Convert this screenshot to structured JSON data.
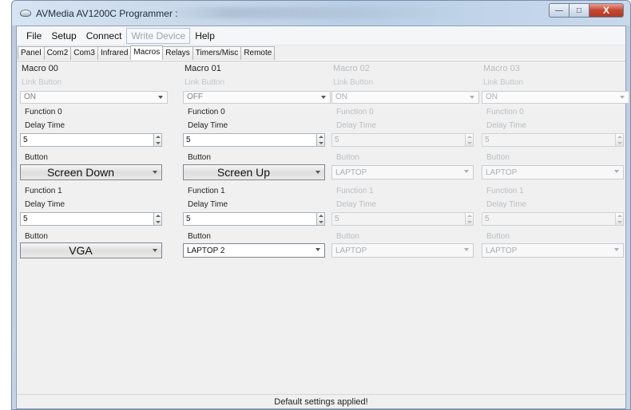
{
  "window": {
    "title": "AVMedia AV1200C Programmer :",
    "minimize_glyph": "—",
    "maximize_glyph": "□",
    "close_glyph": "X"
  },
  "menu": [
    "File",
    "Setup",
    "Connect",
    "Write Device",
    "Help"
  ],
  "tabs": [
    "Panel",
    "Com2",
    "Com3",
    "Infrared",
    "Macros",
    "Relays",
    "Timers/Misc",
    "Remote"
  ],
  "active_tab": "Macros",
  "macros": [
    {
      "title": "Macro 00",
      "link_label": "Link Button",
      "link_value": "ON",
      "f0_label": "Function 0",
      "f0_delay_label": "Delay Time",
      "f0_delay": "5",
      "f0_button_label": "Button",
      "f0_button": "Screen Down",
      "f1_label": "Function 1",
      "f1_delay_label": "Delay Time",
      "f1_delay": "5",
      "f1_button_label": "Button",
      "f1_button": "VGA"
    },
    {
      "title": "Macro 01",
      "link_label": "Link Button",
      "link_value": "OFF",
      "f0_label": "Function 0",
      "f0_delay_label": "Delay Time",
      "f0_delay": "5",
      "f0_button_label": "Button",
      "f0_button": "Screen Up",
      "f1_label": "Function 1",
      "f1_delay_label": "Delay Time",
      "f1_delay": "5",
      "f1_button_label": "Button",
      "f1_button": "LAPTOP 2"
    },
    {
      "title": "Macro 02",
      "link_label": "Link Button",
      "link_value": "ON",
      "f0_label": "Function 0",
      "f0_delay_label": "Delay Time",
      "f0_delay": "5",
      "f0_button_label": "Button",
      "f0_button": "LAPTOP",
      "f1_label": "Function 1",
      "f1_delay_label": "Delay Time",
      "f1_delay": "5",
      "f1_button_label": "Button",
      "f1_button": "LAPTOP"
    },
    {
      "title": "Macro 03",
      "link_label": "Link Button",
      "link_value": "ON",
      "f0_label": "Function 0",
      "f0_delay_label": "Delay Time",
      "f0_delay": "5",
      "f0_button_label": "Button",
      "f0_button": "LAPTOP",
      "f1_label": "Function 1",
      "f1_delay_label": "Delay Time",
      "f1_delay": "5",
      "f1_button_label": "Button",
      "f1_button": "LAPTOP"
    }
  ],
  "status": "Default settings applied!"
}
